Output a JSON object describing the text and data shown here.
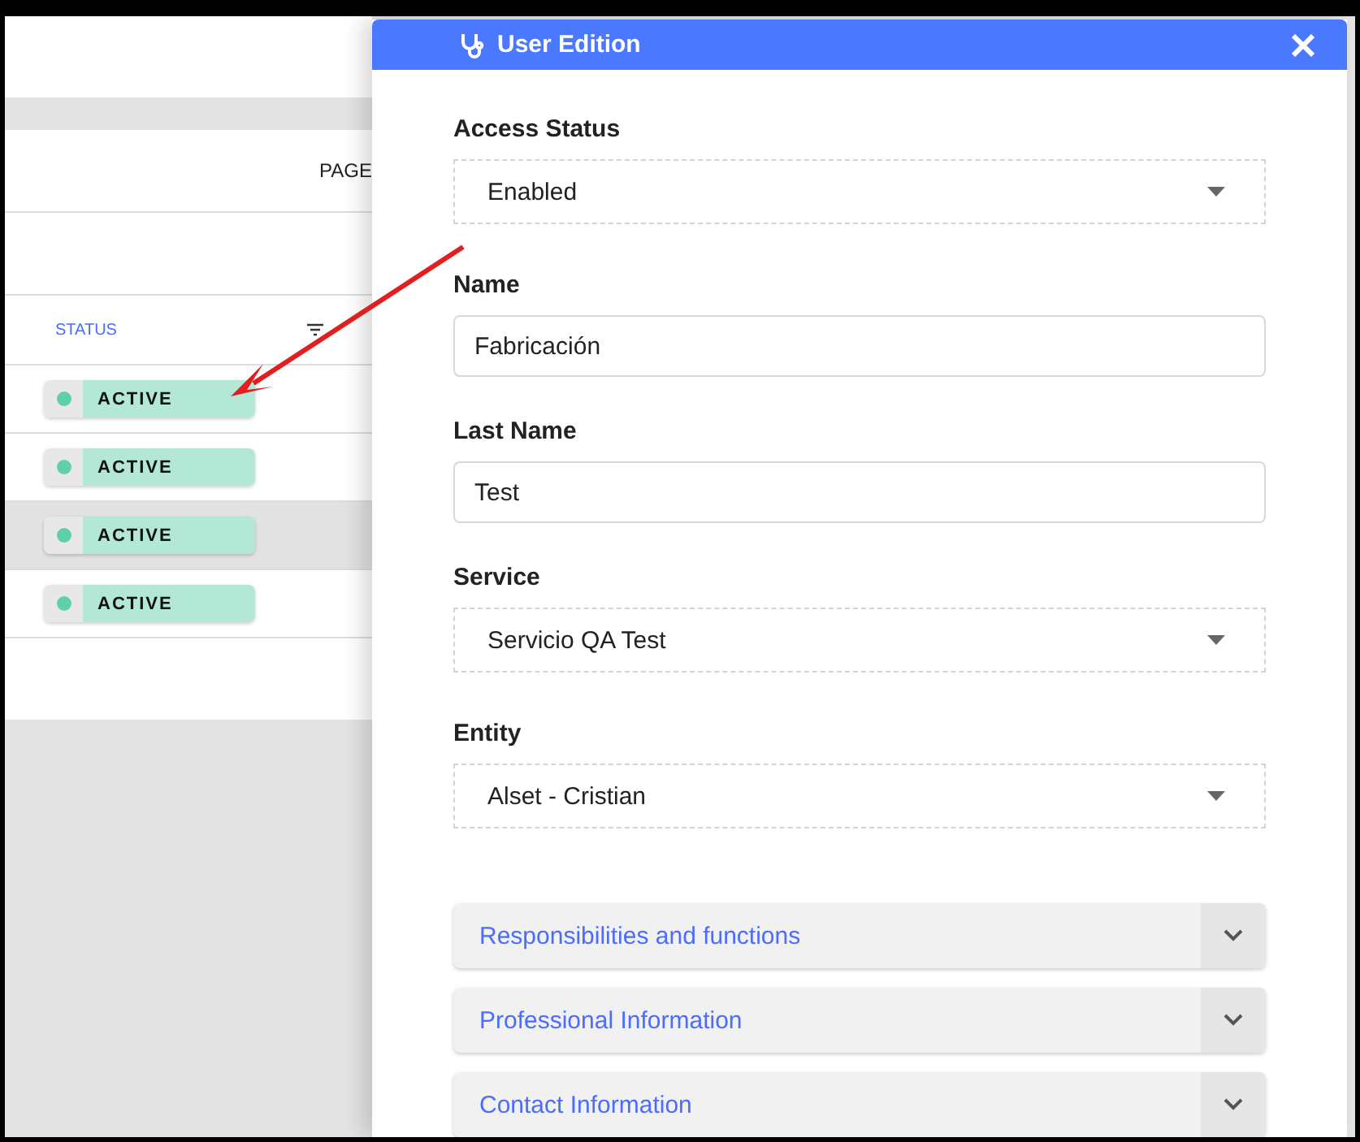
{
  "page": {
    "pagination_label": "PAGE",
    "table": {
      "columns": [
        {
          "label": "STATUS"
        }
      ],
      "rows": [
        {
          "status": "ACTIVE",
          "selected": false
        },
        {
          "status": "ACTIVE",
          "selected": false
        },
        {
          "status": "ACTIVE",
          "selected": true
        },
        {
          "status": "ACTIVE",
          "selected": false
        }
      ]
    }
  },
  "panel": {
    "title": "User Edition",
    "fields": [
      {
        "label": "Access Status",
        "kind": "select",
        "value": "Enabled"
      },
      {
        "label": "Name",
        "kind": "input",
        "value": "Fabricación"
      },
      {
        "label": "Last Name",
        "kind": "input",
        "value": "Test"
      },
      {
        "label": "Service",
        "kind": "select",
        "value": "Servicio QA Test"
      },
      {
        "label": "Entity",
        "kind": "select",
        "value": "Alset - Cristian"
      }
    ],
    "sections": [
      {
        "title": "Responsibilities and functions",
        "expanded": false
      },
      {
        "title": "Professional Information",
        "expanded": false
      },
      {
        "title": "Contact Information",
        "expanded": false
      }
    ]
  }
}
